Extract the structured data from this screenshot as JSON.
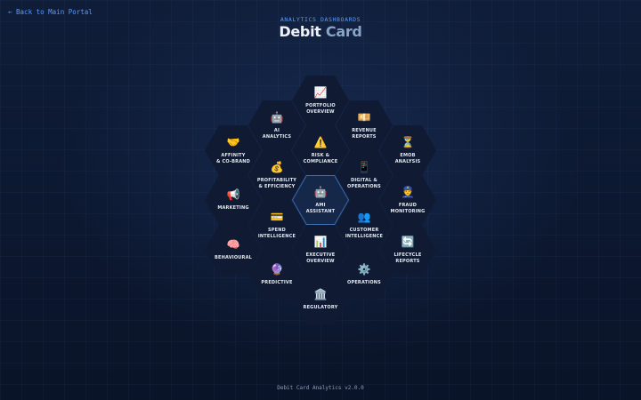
{
  "nav": {
    "back_label": "← Back to Main Portal"
  },
  "header": {
    "eyebrow": "ANALYTICS DASHBOARDS",
    "title_main": "Debit",
    "title_accent": "Card"
  },
  "hexes": [
    {
      "id": "portfolio-overview",
      "icon": "📈",
      "icon_name": "chart-increasing-icon",
      "label": "PORTFOLIO\nOVERVIEW"
    },
    {
      "id": "ai-analytics",
      "icon": "🤖",
      "icon_name": "robot-icon",
      "label": "AI\nANALYTICS"
    },
    {
      "id": "revenue-reports",
      "icon": "💴",
      "icon_name": "banknote-icon",
      "label": "REVENUE\nREPORTS"
    },
    {
      "id": "affinity-co-brand",
      "icon": "🤝",
      "icon_name": "handshake-icon",
      "label": "AFFINITY\n& CO-BRAND"
    },
    {
      "id": "risk-compliance",
      "icon": "⚠️",
      "icon_name": "warning-icon",
      "label": "RISK &\nCOMPLIANCE"
    },
    {
      "id": "emob-analysis",
      "icon": "⏳",
      "icon_name": "hourglass-icon",
      "label": "EMOB\nANALYSIS"
    },
    {
      "id": "profitability-efficiency",
      "icon": "💰",
      "icon_name": "money-bag-icon",
      "label": "PROFITABILITY\n& EFFICIENCY"
    },
    {
      "id": "digital-operations",
      "icon": "📱",
      "icon_name": "mobile-phone-icon",
      "label": "DIGITAL &\nOPERATIONS"
    },
    {
      "id": "marketing",
      "icon": "📢",
      "icon_name": "megaphone-icon",
      "label": "MARKETING"
    },
    {
      "id": "ami-assistant",
      "icon": "🤖",
      "icon_name": "robot-icon",
      "label": "AMI\nASSISTANT"
    },
    {
      "id": "fraud-monitoring",
      "icon": "👮",
      "icon_name": "police-officer-icon",
      "label": "FRAUD\nMONITORING"
    },
    {
      "id": "spend-intelligence",
      "icon": "💳",
      "icon_name": "credit-card-icon",
      "label": "SPEND\nINTELLIGENCE"
    },
    {
      "id": "customer-intelligence",
      "icon": "👥",
      "icon_name": "people-icon",
      "label": "CUSTOMER\nINTELLIGENCE"
    },
    {
      "id": "behavioural",
      "icon": "🧠",
      "icon_name": "brain-icon",
      "label": "BEHAVIOURAL"
    },
    {
      "id": "executive-overview",
      "icon": "📊",
      "icon_name": "bar-chart-icon",
      "label": "EXECUTIVE\nOVERVIEW"
    },
    {
      "id": "lifecycle-reports",
      "icon": "🔄",
      "icon_name": "refresh-icon",
      "label": "LIFECYCLE\nREPORTS"
    },
    {
      "id": "predictive",
      "icon": "🔮",
      "icon_name": "crystal-ball-icon",
      "label": "PREDICTIVE"
    },
    {
      "id": "operations",
      "icon": "⚙️",
      "icon_name": "gear-icon",
      "label": "OPERATIONS"
    },
    {
      "id": "regulatory",
      "icon": "🏛️",
      "icon_name": "classical-building-icon",
      "label": "REGULATORY"
    }
  ],
  "footer": {
    "text": "Debit Card Analytics v2.0.0"
  }
}
